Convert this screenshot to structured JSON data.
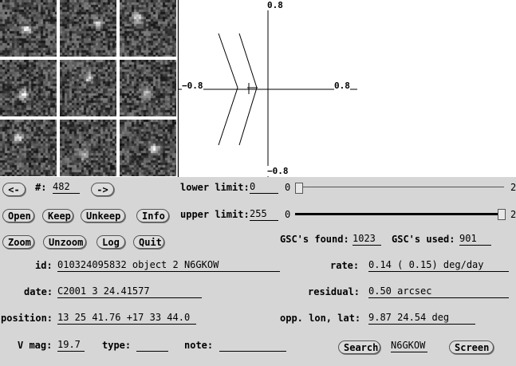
{
  "plot": {
    "ymax": "0.8",
    "ymin": "−0.8",
    "xmin": "−0.8",
    "xmax": "0.8"
  },
  "nav": {
    "prev": "<-",
    "next": "->",
    "num_label": "#:",
    "num_value": "482"
  },
  "lower": {
    "label": "lower limit:",
    "value": "0",
    "min": "0",
    "max": "2",
    "level": 0
  },
  "upper": {
    "label": "upper limit:",
    "value": "255",
    "min": "0",
    "max": "2",
    "level": 1
  },
  "buttons": {
    "open": "Open",
    "keep": "Keep",
    "unkeep": "Unkeep",
    "info": "Info",
    "zoom": "Zoom",
    "unzoom": "Unzoom",
    "log": "Log",
    "quit": "Quit",
    "search": "Search",
    "screen": "Screen"
  },
  "gsc": {
    "found_label": "GSC's found:",
    "found_value": "1023",
    "used_label": "GSC's used:",
    "used_value": "901"
  },
  "fields": {
    "id_label": "id:",
    "id_value": "010324095832 object 2  N6GKOW",
    "rate_label": "rate:",
    "rate_value": "0.14 (  0.15) deg/day",
    "date_label": "date:",
    "date_value": "C2001  3 24.41577",
    "residual_label": "residual:",
    "residual_value": "0.50 arcsec",
    "position_label": "position:",
    "position_value": "13 25 41.76 +17 33 44.0",
    "opp_label": "opp. lon, lat:",
    "opp_value": "9.87 24.54 deg",
    "vmag_label": "V mag:",
    "vmag_value": "19.7",
    "type_label": "type:",
    "type_value": "",
    "note_label": "note:",
    "note_value": "",
    "search_field": "N6GKOW"
  }
}
